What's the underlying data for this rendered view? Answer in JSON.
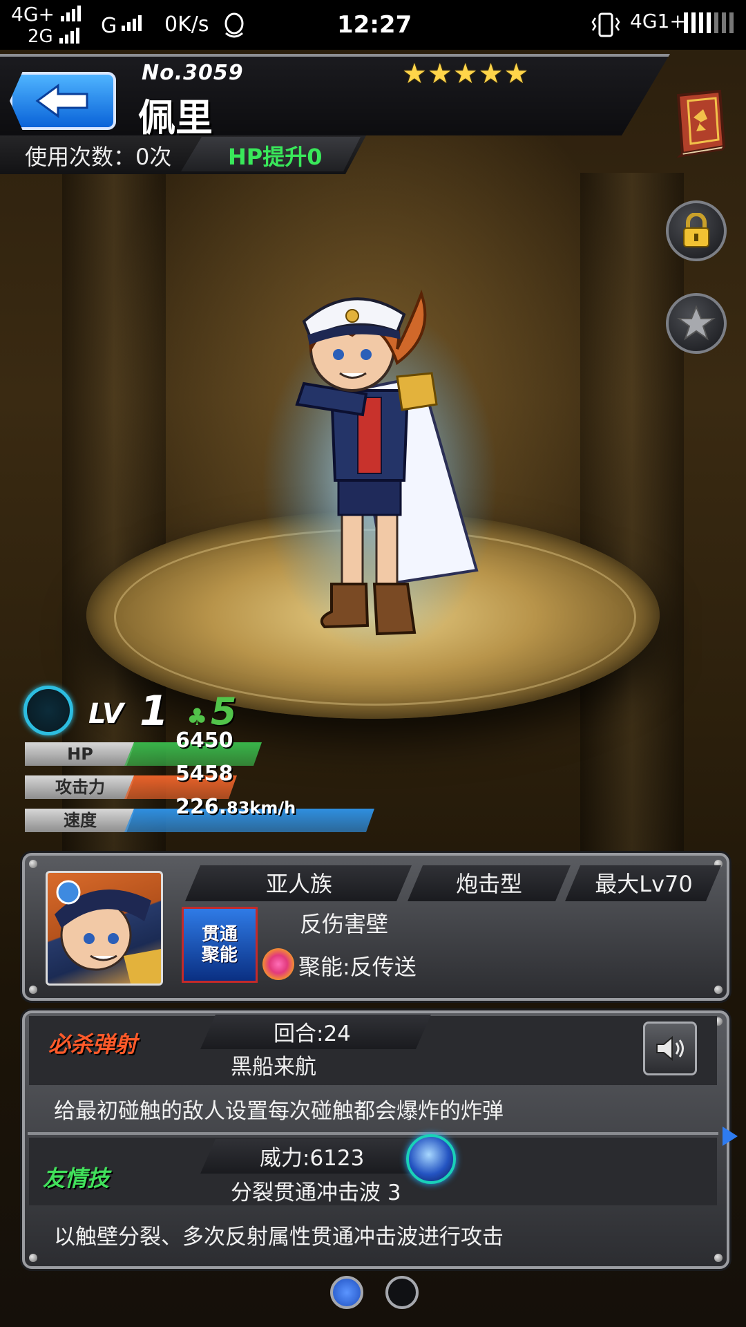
{
  "status_bar": {
    "network_1": "4G+",
    "network_2": "2G",
    "network_3": "G",
    "speed": "0K/s",
    "time": "12:27",
    "network_right": "4G1+"
  },
  "header": {
    "number": "No.3059",
    "name": "佩里",
    "stars": "★★★★★",
    "use_count": "使用次数：0次",
    "hp_up": "HP提升0"
  },
  "stats": {
    "lv_label": "LV",
    "lv_value": "1",
    "luck_value": "5",
    "hp_label": "HP",
    "hp_value": "6450",
    "attack_label": "攻击力",
    "attack_value": "5458",
    "speed_label": "速度",
    "speed_number": "226.",
    "speed_unit": "83km/h",
    "hp_fill": 0.55,
    "attack_fill": 0.45,
    "speed_fill": 1.0
  },
  "info": {
    "race": "亚人族",
    "type": "炮击型",
    "max_lv": "最大Lv70",
    "ability_badge_line1": "贯通",
    "ability_badge_line2": "聚能",
    "ability": "反伤害壁",
    "gauge_ability": "聚能:反传送"
  },
  "skills": {
    "strike_title": "必杀弹射",
    "strike_turns": "回合:24",
    "strike_name": "黑船来航",
    "strike_desc": "给最初碰触的敌人设置每次碰触都会爆炸的炸弹",
    "friend_title": "友情技",
    "friend_power": "威力:6123",
    "friend_name": "分裂贯通冲击波 3",
    "friend_desc": "以触壁分裂、多次反射属性贯通冲击波进行攻击"
  },
  "colors": {
    "hp_bar": "#39b54a",
    "attack_bar": "#e8622a",
    "speed_bar": "#2f8fe0",
    "strike_title": "#ff5a2a",
    "friend_title": "#41e05b",
    "star": "#ffd54a",
    "active_dot": "#2e6fe8"
  },
  "pagination": {
    "current": 1,
    "total": 2
  }
}
